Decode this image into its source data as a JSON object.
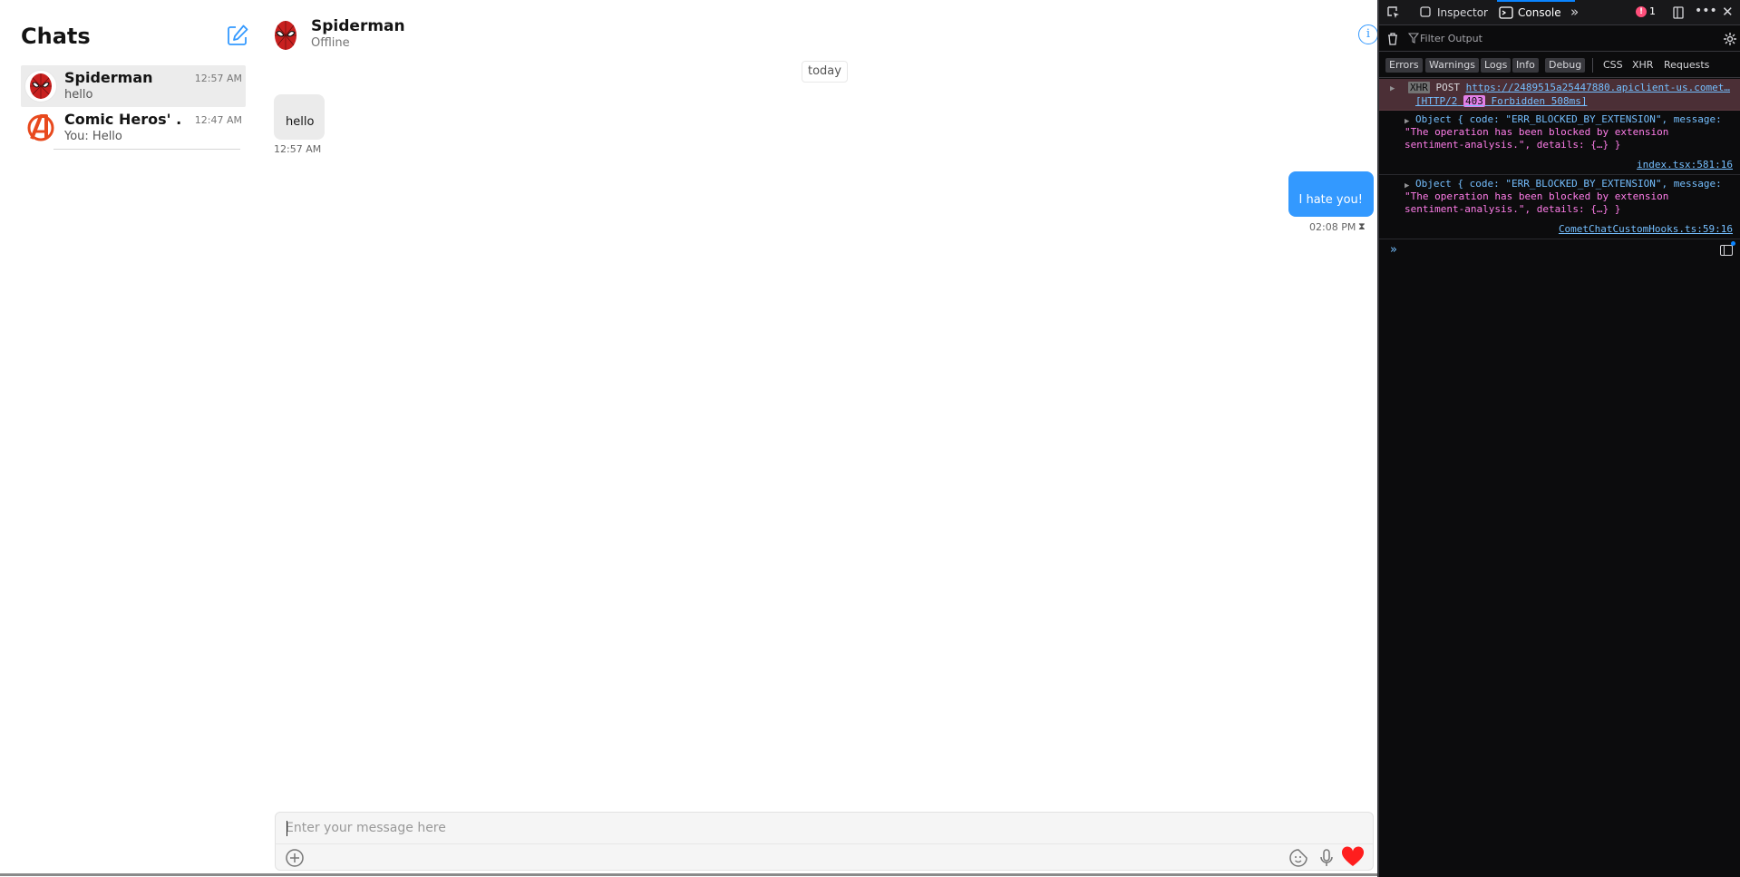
{
  "sidebar": {
    "title": "Chats",
    "chats": [
      {
        "name": "Spiderman",
        "last_message": "hello",
        "time": "12:57 AM"
      },
      {
        "name": "Comic Heros' ...",
        "last_message": "You: Hello",
        "time": "12:47 AM"
      }
    ]
  },
  "conversation": {
    "name": "Spiderman",
    "status": "Offline",
    "info_icon": "i",
    "date_separator": "today",
    "messages": [
      {
        "direction": "incoming",
        "text": "hello",
        "time": "12:57 AM"
      },
      {
        "direction": "outgoing",
        "text": "I hate you!",
        "time": "02:08 PM",
        "status_glyph": "⧗"
      }
    ]
  },
  "composer": {
    "placeholder": "Enter your message here"
  },
  "devtools": {
    "tabs": [
      "Inspector",
      "Console"
    ],
    "active_tab": "Console",
    "error_count": "1",
    "filter_placeholder": "Filter Output",
    "levels": [
      "Errors",
      "Warnings",
      "Logs",
      "Info",
      "Debug"
    ],
    "extra_filters": [
      "CSS",
      "XHR",
      "Requests"
    ],
    "logs": {
      "xhr": {
        "tag": "XHR",
        "method": "POST",
        "url": "https://2489515a25447880.apiclient-us.comet…",
        "protocol": "[HTTP/2",
        "status": "403",
        "status_text": "Forbidden 508ms]"
      },
      "objects": [
        {
          "line1": "Object { code: \"ERR_BLOCKED_BY_EXTENSION\", message:",
          "line2": "\"The operation has been blocked by extension",
          "line3": "sentiment-analysis.\", details: {…} }",
          "source": "index.tsx:581:16"
        },
        {
          "line1": "Object { code: \"ERR_BLOCKED_BY_EXTENSION\", message:",
          "line2": "\"The operation has been blocked by extension",
          "line3": "sentiment-analysis.\", details: {…} }",
          "source": "CometChatCustomHooks.ts:59:16"
        }
      ]
    },
    "prompt_glyph": "»"
  },
  "colors": {
    "accent": "#3399ff",
    "heart": "#ff1e1e",
    "devtools_bg": "#0c0c0d",
    "error_row": "#4b2f36"
  },
  "icons": [
    "compose-icon",
    "spiderman-avatar",
    "avengers-avatar",
    "info-icon",
    "add-icon",
    "sticker-icon",
    "microphone-icon",
    "heart-icon",
    "trash-icon",
    "filter-icon",
    "settings-icon",
    "pick-element-icon",
    "close-icon",
    "more-icon",
    "responsive-icon"
  ]
}
